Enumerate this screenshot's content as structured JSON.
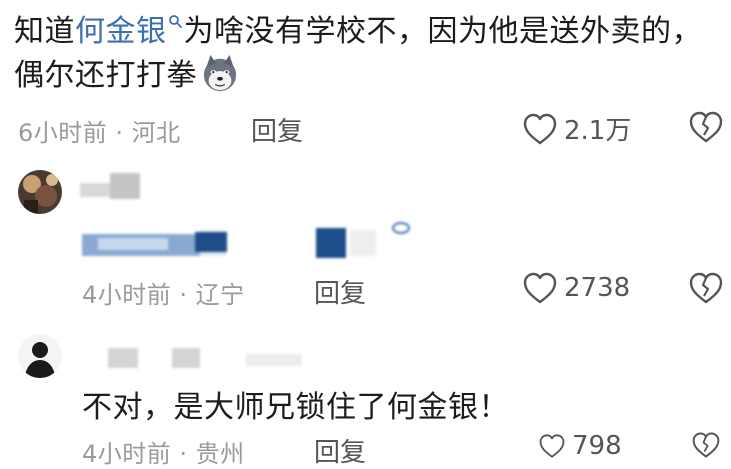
{
  "main_comment": {
    "text_before": "知道",
    "mention": "何金银",
    "text_after": "为啥没有学校不，因为他是送外卖的，偶尔还打打拳",
    "time": "6小时前",
    "location": "河北",
    "reply_label": "回复",
    "like_count": "2.1万"
  },
  "reply_1": {
    "username": "",
    "time": "4小时前",
    "location": "辽宁",
    "reply_label": "回复",
    "like_count": "2738"
  },
  "reply_2": {
    "text": "不对，是大师兄锁住了何金银！",
    "time": "4小时前",
    "location": "贵州",
    "reply_label": "回复",
    "like_count": "798"
  },
  "separator": " · ",
  "colors": {
    "mention": "#3c6fb4",
    "meta": "#9a9a9a",
    "text": "#1c1c1c",
    "action": "#555555"
  },
  "icons": [
    "search-icon",
    "husky-emoji-icon",
    "heart-icon",
    "broken-heart-icon"
  ]
}
